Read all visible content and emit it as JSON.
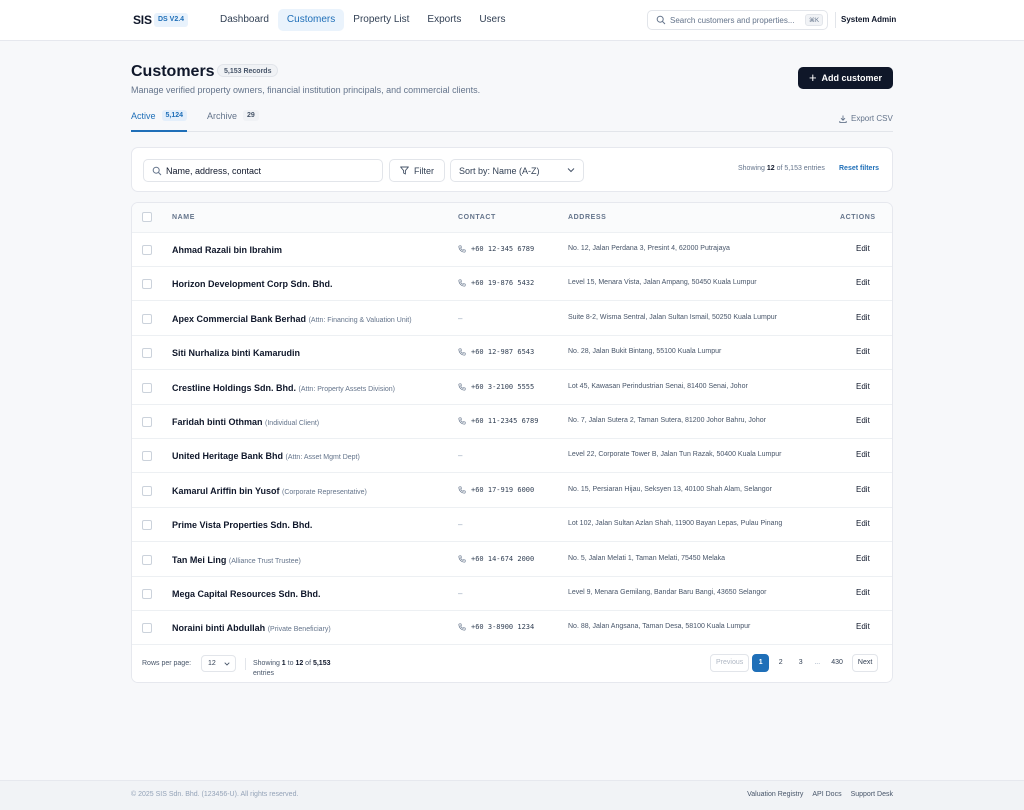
{
  "app": {
    "brand": "SIS",
    "version": "DS V2.4",
    "nav": [
      "Dashboard",
      "Customers",
      "Property List",
      "Exports",
      "Users"
    ],
    "active_nav": "Customers",
    "search_placeholder": "Search customers and properties...",
    "search_shortcut": "⌘K",
    "user": "System Admin"
  },
  "header": {
    "title": "Customers",
    "record_count": "5,153 Records",
    "subtitle": "Manage verified property owners, financial institution principals, and commercial clients.",
    "add_button": "Add customer"
  },
  "tabs": [
    {
      "label": "Active",
      "count": "5,124",
      "active": true
    },
    {
      "label": "Archive",
      "count": "29",
      "active": false
    }
  ],
  "export_label": "Export CSV",
  "filters": {
    "search_value": "Name, address, contact",
    "filter_label": "Filter",
    "sort_label": "Sort by: Name (A-Z)",
    "showing_prefix": "Showing",
    "showing_count": "12",
    "showing_suffix": "of 5,153 entries",
    "reset_label": "Reset filters"
  },
  "table": {
    "columns": [
      "NAME",
      "CONTACT",
      "ADDRESS",
      "ACTIONS"
    ],
    "edit_label": "Edit",
    "rows": [
      {
        "name": "Ahmad Razali bin Ibrahim",
        "attn": "",
        "contact": "+60 12-345 6789",
        "address": "No. 12, Jalan Perdana 3, Presint 4, 62000 Putrajaya"
      },
      {
        "name": "Horizon Development Corp Sdn. Bhd.",
        "attn": "",
        "contact": "+60 19-876 5432",
        "address": "Level 15, Menara Vista, Jalan Ampang, 50450 Kuala Lumpur"
      },
      {
        "name": "Apex Commercial Bank Berhad",
        "attn": "(Attn: Financing & Valuation Unit)",
        "contact": "–",
        "address": "Suite 8-2, Wisma Sentral, Jalan Sultan Ismail, 50250 Kuala Lumpur"
      },
      {
        "name": "Siti Nurhaliza binti Kamarudin",
        "attn": "",
        "contact": "+60 12-987 6543",
        "address": "No. 28, Jalan Bukit Bintang, 55100 Kuala Lumpur"
      },
      {
        "name": "Crestline Holdings Sdn. Bhd.",
        "attn": "(Attn: Property Assets Division)",
        "contact": "+60 3-2100 5555",
        "address": "Lot 45, Kawasan Perindustrian Senai, 81400 Senai, Johor"
      },
      {
        "name": "Faridah binti Othman",
        "attn": "(Individual Client)",
        "contact": "+60 11-2345 6789",
        "address": "No. 7, Jalan Sutera 2, Taman Sutera, 81200 Johor Bahru, Johor"
      },
      {
        "name": "United Heritage Bank Bhd",
        "attn": "(Attn: Asset Mgmt Dept)",
        "contact": "–",
        "address": "Level 22, Corporate Tower B, Jalan Tun Razak, 50400 Kuala Lumpur"
      },
      {
        "name": "Kamarul Ariffin bin Yusof",
        "attn": "(Corporate Representative)",
        "contact": "+60 17-919 6000",
        "address": "No. 15, Persiaran Hijau, Seksyen 13, 40100 Shah Alam, Selangor"
      },
      {
        "name": "Prime Vista Properties Sdn. Bhd.",
        "attn": "",
        "contact": "–",
        "address": "Lot 102, Jalan Sultan Azlan Shah, 11900 Bayan Lepas, Pulau Pinang"
      },
      {
        "name": "Tan Mei Ling",
        "attn": "(Alliance Trust Trustee)",
        "contact": "+60 14-674 2000",
        "address": "No. 5, Jalan Melati 1, Taman Melati, 75450 Melaka"
      },
      {
        "name": "Mega Capital Resources Sdn. Bhd.",
        "attn": "",
        "contact": "–",
        "address": "Level 9, Menara Gemilang, Bandar Baru Bangi, 43650 Selangor"
      },
      {
        "name": "Noraini binti Abdullah",
        "attn": "(Private Beneficiary)",
        "contact": "+60 3-8900 1234",
        "address": "No. 88, Jalan Angsana, Taman Desa, 58100 Kuala Lumpur"
      }
    ]
  },
  "pagination": {
    "rows_per_page_label": "Rows per page:",
    "rows_per_page": "12",
    "showing_text": [
      "Showing ",
      "1",
      " to ",
      "12",
      " of ",
      "5,153",
      " entries"
    ],
    "previous": "Previous",
    "pages": [
      "1",
      "2",
      "3",
      "...",
      "430"
    ],
    "current_page": "1",
    "next": "Next"
  },
  "footer": {
    "copyright": "© 2025 SIS Sdn. Bhd. (123456-U). All rights reserved.",
    "links": [
      "Valuation Registry",
      "API Docs",
      "Support Desk"
    ]
  },
  "colors": {
    "accent": "#1f6fb8",
    "primary_button": "#0f1729"
  }
}
